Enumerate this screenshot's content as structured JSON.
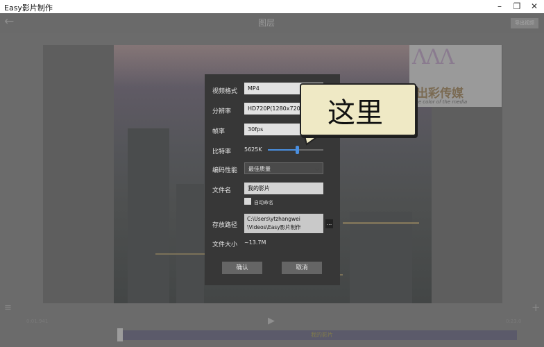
{
  "window": {
    "title": "Easy影片制作"
  },
  "appbar": {
    "title": "图层",
    "export_label": "导出视频"
  },
  "logo": {
    "zh": "出彩传媒",
    "en": "The color of the media"
  },
  "dialog": {
    "fields": {
      "video_format": {
        "label": "视频格式",
        "value": "MP4"
      },
      "resolution": {
        "label": "分辨率",
        "value": "HD720P(1280x720)"
      },
      "framerate": {
        "label": "帧率",
        "value": "30fps"
      },
      "bitrate": {
        "label": "比特率",
        "value": "5625K",
        "level_pct": 53
      },
      "encode_perf": {
        "label": "编码性能",
        "value": "最佳质量"
      },
      "filename": {
        "label": "文件名",
        "value": "我的影片"
      },
      "auto_name": {
        "label": "自动命名",
        "checked": false
      },
      "save_path": {
        "label": "存放路径",
        "value_line1": "C:\\Users\\ytzhangwei",
        "value_line2": "\\Videos\\Easy影片制作",
        "browse": "..."
      },
      "file_size": {
        "label": "文件大小",
        "value": "~13.7M"
      }
    },
    "confirm_label": "确认",
    "cancel_label": "取消"
  },
  "callout": {
    "text": "这里"
  },
  "timeline": {
    "time_left": "0:01.941",
    "time_right": "0:23.0",
    "clip_label": "我的影片"
  }
}
